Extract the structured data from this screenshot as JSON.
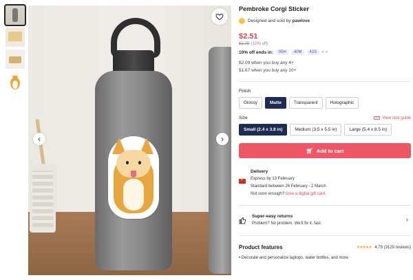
{
  "product": {
    "title": "Pembroke Corgi Sticker",
    "seller_prefix": "Designed and sold by",
    "seller_name": "pawlove"
  },
  "pricing": {
    "price": "$2.51",
    "original_price": "$2.79",
    "discount": "(10% off)",
    "sale_label": "10% off ends in:",
    "timer": [
      "05H",
      "40M",
      "42S"
    ],
    "bulk": [
      "$2.09 when you buy any 4+",
      "$1.67 when you buy any 10+"
    ]
  },
  "finish": {
    "label": "Finish",
    "options": [
      "Glossy",
      "Matte",
      "Transparent",
      "Holographic"
    ],
    "selected": "Matte"
  },
  "size": {
    "label": "Size",
    "guide_label": "View size guide",
    "options": [
      "Small (2.4 x 3.8 in)",
      "Medium (3.5 x 5.5 in)",
      "Large (5.4 x 8.5 in)"
    ],
    "selected": "Small (2.4 x 3.8 in)"
  },
  "cart": {
    "label": "Add to cart"
  },
  "delivery": {
    "heading": "Delivery",
    "express": "Express by 13 February",
    "standard": "Standard between 26 February - 2 March",
    "not_soon": "Not soon enough?",
    "gift_link": "Give a digital gift card."
  },
  "returns": {
    "heading": "Super-easy returns",
    "text": "Problem? No problem. We'll fix it. fast."
  },
  "features": {
    "heading": "Product features",
    "rating": "4.79",
    "reviews": "(3129 reviews)",
    "first_item": "Decorate and personalize laptops, water bottles, and more"
  },
  "icons": {
    "heart": "heart-icon",
    "prev": "chevron-left-icon",
    "next": "chevron-right-icon",
    "cart": "cart-icon",
    "ruler": "ruler-icon",
    "thumbs_up": "thumbs-up-icon",
    "chevron": "chevron-right-icon"
  },
  "colors": {
    "accent": "#e2444f",
    "cart_button": "#ee5866",
    "selected_option": "#1e2b52",
    "timer_chip": "#eef0fd"
  }
}
